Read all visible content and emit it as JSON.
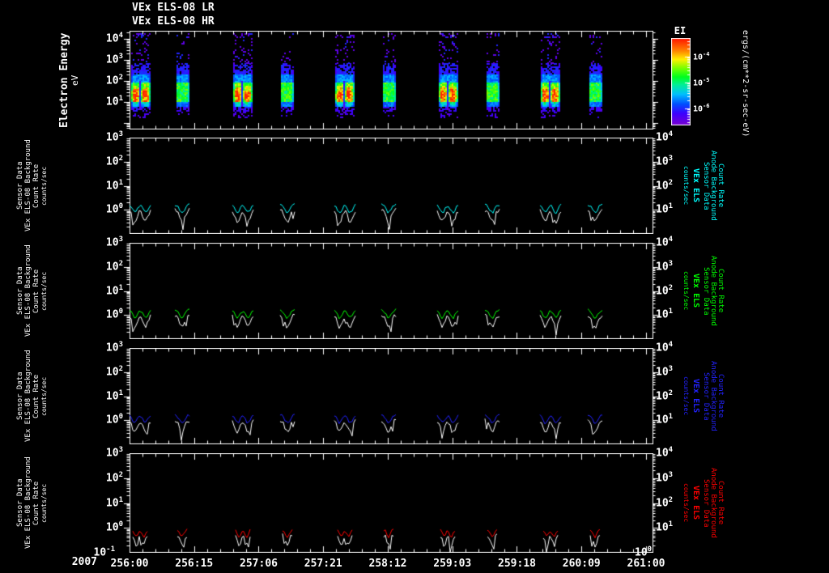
{
  "background": "#000000",
  "frame_color": "#ffffff",
  "title": {
    "line1": "VEx ELS-08 LR",
    "line2": "VEx ELS-08 HR"
  },
  "bottom_axis": {
    "year": "2007",
    "tick_labels": [
      "256:00",
      "256:15",
      "257:06",
      "257:21",
      "258:12",
      "259:03",
      "259:18",
      "260:09",
      "261:00"
    ],
    "bottom_left_exponent": -1,
    "bottom_right_exponent": 0
  },
  "spectrogram_panel": {
    "ylabel_main": "Electron Energy",
    "ylabel_unit": "eV",
    "ytick_exponents": [
      4,
      3,
      2,
      1
    ],
    "colorbar": {
      "title": "EI",
      "tick_exponents": [
        -4,
        -5,
        -6
      ],
      "unit_label": "ergs/(cm**2-sr-sec-eV)"
    }
  },
  "line_panels": [
    {
      "id": "panel-cyan",
      "color": "#00ffff",
      "left_label_lines": [
        "Sensor Data",
        "VEx ELS-08 Background",
        "Count Rate",
        "counts/sec"
      ],
      "right_label": {
        "title": "VEx ELS",
        "lines": [
          "Sensor Data",
          "Anode Background",
          "Count Rate"
        ],
        "unit": "counts/sec"
      },
      "left_tick_exponents": [
        3,
        2,
        1,
        0
      ],
      "right_tick_exponents": [
        4,
        3,
        2,
        1
      ]
    },
    {
      "id": "panel-green",
      "color": "#00ff00",
      "left_label_lines": [
        "Sensor Data",
        "VEx ELS-08 Background",
        "Count Rate",
        "counts/sec"
      ],
      "right_label": {
        "title": "VEx ELS",
        "lines": [
          "Sensor Data",
          "Anode Background",
          "Count Rate"
        ],
        "unit": "counts/sec"
      },
      "left_tick_exponents": [
        3,
        2,
        1,
        0
      ],
      "right_tick_exponents": [
        4,
        3,
        2,
        1
      ]
    },
    {
      "id": "panel-blue",
      "color": "#2222ff",
      "left_label_lines": [
        "Sensor Data",
        "VEx ELS-08 Background",
        "Count Rate",
        "counts/sec"
      ],
      "right_label": {
        "title": "VEx ELS",
        "lines": [
          "Sensor Data",
          "Anode Background",
          "Count Rate"
        ],
        "unit": "counts/sec"
      },
      "left_tick_exponents": [
        3,
        2,
        1,
        0
      ],
      "right_tick_exponents": [
        4,
        3,
        2,
        1
      ]
    },
    {
      "id": "panel-red",
      "color": "#ff0000",
      "left_label_lines": [
        "Sensor Data",
        "VEx ELS-08 Background",
        "Count Rate",
        "counts/sec"
      ],
      "right_label": {
        "title": "VEx ELS",
        "lines": [
          "Sensor Data",
          "Anode Background",
          "Count Rate"
        ],
        "unit": "counts/sec"
      },
      "left_tick_exponents": [
        3,
        2,
        1,
        0
      ],
      "right_tick_exponents": [
        4,
        3,
        2,
        1
      ]
    }
  ],
  "chart_data": {
    "type": [
      "spectrogram",
      "line",
      "line",
      "line",
      "line"
    ],
    "title": "VEx ELS-08 LR / VEx ELS-08 HR",
    "x_axis": {
      "year": 2007,
      "units": "day_of_year:hour",
      "tick_labels": [
        "256:00",
        "256:15",
        "257:06",
        "257:21",
        "258:12",
        "259:03",
        "259:18",
        "260:09",
        "261:00"
      ],
      "step_hours": 15,
      "range": [
        "256:00",
        "261:00"
      ]
    },
    "spectrogram": {
      "ylabel": "Electron Energy (eV)",
      "yscale": "log",
      "ytick_values_ev": [
        10000,
        1000,
        100,
        10
      ],
      "flux_units": "ergs/(cm**2-sr-sec-eV)",
      "colorbar_tick_values": [
        0.0001,
        1e-05,
        1e-06
      ],
      "description": "Periodic periapsis bursts: broad green band 10-600 eV, red-orange cores 10-40 eV in wide bursts with dark central notch, purple-blue speckle above 1 keV",
      "bursts": [
        {
          "center_frac": 0.0204,
          "kind": "wide"
        },
        {
          "center_frac": 0.1019,
          "kind": "narrow"
        },
        {
          "center_frac": 0.2194,
          "kind": "wide"
        },
        {
          "center_frac": 0.3056,
          "kind": "narrow"
        },
        {
          "center_frac": 0.4169,
          "kind": "wide"
        },
        {
          "center_frac": 0.5016,
          "kind": "narrow"
        },
        {
          "center_frac": 0.616,
          "kind": "wide"
        },
        {
          "center_frac": 0.7022,
          "kind": "narrow"
        },
        {
          "center_frac": 0.815,
          "kind": "wide"
        },
        {
          "center_frac": 0.9013,
          "kind": "narrow"
        }
      ]
    },
    "line_panels": {
      "ylabel": "VEx ELS-08 Background Count Rate (counts/sec)",
      "yscale": "log",
      "left_axis_range": [
        0.1,
        1000
      ],
      "right_axis_range": [
        1,
        10000
      ],
      "series_log10_baselines": {
        "colored_trace": 0.22,
        "white_trace": 0.0,
        "red_panel_colored_trace": -0.08,
        "red_panel_white_trace": -0.3
      },
      "segments": [
        {
          "center_frac": 0.0204,
          "kind": "wide"
        },
        {
          "center_frac": 0.1019,
          "kind": "narrow"
        },
        {
          "center_frac": 0.2194,
          "kind": "wide"
        },
        {
          "center_frac": 0.3056,
          "kind": "narrow"
        },
        {
          "center_frac": 0.4169,
          "kind": "wide"
        },
        {
          "center_frac": 0.5016,
          "kind": "narrow"
        },
        {
          "center_frac": 0.616,
          "kind": "wide"
        },
        {
          "center_frac": 0.7022,
          "kind": "narrow"
        },
        {
          "center_frac": 0.815,
          "kind": "wide"
        },
        {
          "center_frac": 0.9013,
          "kind": "narrow"
        }
      ]
    }
  }
}
